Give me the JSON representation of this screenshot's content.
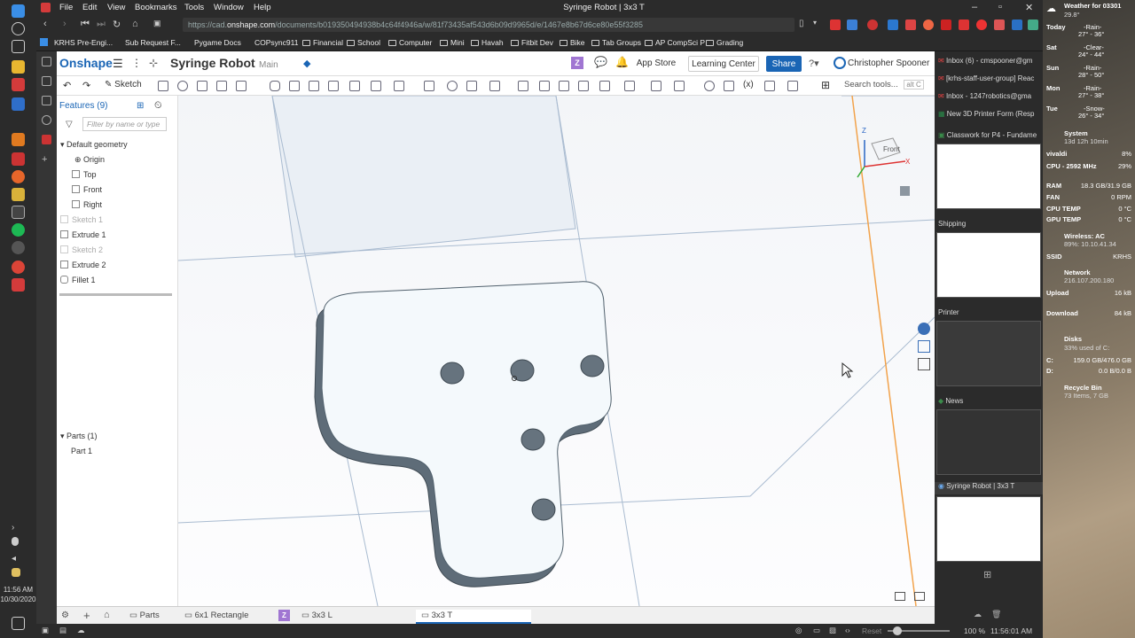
{
  "browser": {
    "menu": [
      "File",
      "Edit",
      "View",
      "Bookmarks",
      "Tools",
      "Window",
      "Help"
    ],
    "window_title": "Syringe Robot | 3x3 T",
    "url_prefix": "https://cad.",
    "url_domain": "onshape.com",
    "url_rest": "/documents/b019350494938b4c64f4946a/w/81f73435af543d6b09d9965d/e/1467e8b67d6ce80e55f3285",
    "bookmarks": [
      "KRHS Pre-Engi...",
      "Sub Request F...",
      "Pygame Docs",
      "COPsync911",
      "Financial",
      "School",
      "Computer",
      "Mini",
      "Havah",
      "Fitbit Dev",
      "Bike",
      "Tab Groups",
      "AP CompSci P",
      "Grading"
    ]
  },
  "onshape": {
    "logo": "Onshape",
    "doc_title": "Syringe Robot",
    "branch": "Main",
    "app_store": "App Store",
    "learning_center": "Learning Center",
    "share": "Share",
    "user": "Christopher Spooner",
    "sketch_label": "Sketch",
    "search_tools": "Search tools...",
    "search_shortcut": "alt C",
    "features_header": "Features (9)",
    "filter_placeholder": "Filter by name or type",
    "default_geometry": "Default geometry",
    "features": [
      {
        "label": "Origin",
        "dim": false
      },
      {
        "label": "Top",
        "dim": false
      },
      {
        "label": "Front",
        "dim": false
      },
      {
        "label": "Right",
        "dim": false
      },
      {
        "label": "Sketch 1",
        "dim": true
      },
      {
        "label": "Extrude 1",
        "dim": false
      },
      {
        "label": "Sketch 2",
        "dim": true
      },
      {
        "label": "Extrude 2",
        "dim": false
      },
      {
        "label": "Fillet 1",
        "dim": false
      }
    ],
    "parts_header": "Parts (1)",
    "part_1": "Part 1",
    "viewcube_label": "Front",
    "axis_z": "Z",
    "axis_x": "X",
    "tabs": [
      "Parts",
      "6x1 Rectangle",
      "3x3 L",
      "3x3 T"
    ],
    "tab_z_badge": "Z"
  },
  "statusbar": {
    "reset": "Reset",
    "zoom": "100 %",
    "time": "11:56:01 AM"
  },
  "tab_panel": [
    {
      "label": "Inbox (6) - cmspooner@gm"
    },
    {
      "label": "[krhs-staff-user-group] Reac"
    },
    {
      "label": "Inbox - 1247robotics@gma"
    },
    {
      "label": "New 3D Printer Form (Resp"
    },
    {
      "label": "Classwork for P4 - Fundame"
    },
    {
      "label": "Shipping"
    },
    {
      "label": "Printer"
    },
    {
      "label": "News"
    },
    {
      "label": "Syringe Robot | 3x3 T"
    }
  ],
  "desktop": {
    "weather_title": "Weather for 03301",
    "weather_temp": "29.8°",
    "forecast": [
      {
        "day": "Today",
        "cond": "-Rain-",
        "range": "27° - 36°"
      },
      {
        "day": "Sat",
        "cond": "-Clear-",
        "range": "24° - 44°"
      },
      {
        "day": "Sun",
        "cond": "-Rain-",
        "range": "28° - 50°"
      },
      {
        "day": "Mon",
        "cond": "-Rain-",
        "range": "27° - 38°"
      },
      {
        "day": "Tue",
        "cond": "-Snow-",
        "range": "26° - 34°"
      }
    ],
    "system_title": "System",
    "uptime": "13d 12h 10min",
    "vivaldi_label": "vivaldi",
    "vivaldi_pct": "8%",
    "cpu_label": "CPU - 2592 MHz",
    "cpu_pct": "29%",
    "ram_label": "RAM",
    "ram_val": "18.3 GB/31.9 GB",
    "fan_label": "FAN",
    "fan_val": "0 RPM",
    "cpu_temp_label": "CPU TEMP",
    "cpu_temp_val": "0 °C",
    "gpu_temp_label": "GPU TEMP",
    "gpu_temp_val": "0 °C",
    "wireless_title": "Wireless: AC",
    "wireless_sub": "89%: 10.10.41.34",
    "ssid_label": "SSID",
    "ssid_val": "KRHS",
    "network_title": "Network",
    "network_ip": "216.107.200.180",
    "upload_label": "Upload",
    "upload_val": "16 kB",
    "download_label": "Download",
    "download_val": "84 kB",
    "disks_title": "Disks",
    "disks_sub": "33% used of C:",
    "c_label": "C:",
    "c_val": "159.0 GB/476.0 GB",
    "d_label": "D:",
    "d_val": "0.0 B/0.0 B",
    "recycle_title": "Recycle Bin",
    "recycle_sub": "73 Items, 7 GB"
  },
  "os": {
    "time": "11:56 AM",
    "date": "10/30/2020"
  }
}
